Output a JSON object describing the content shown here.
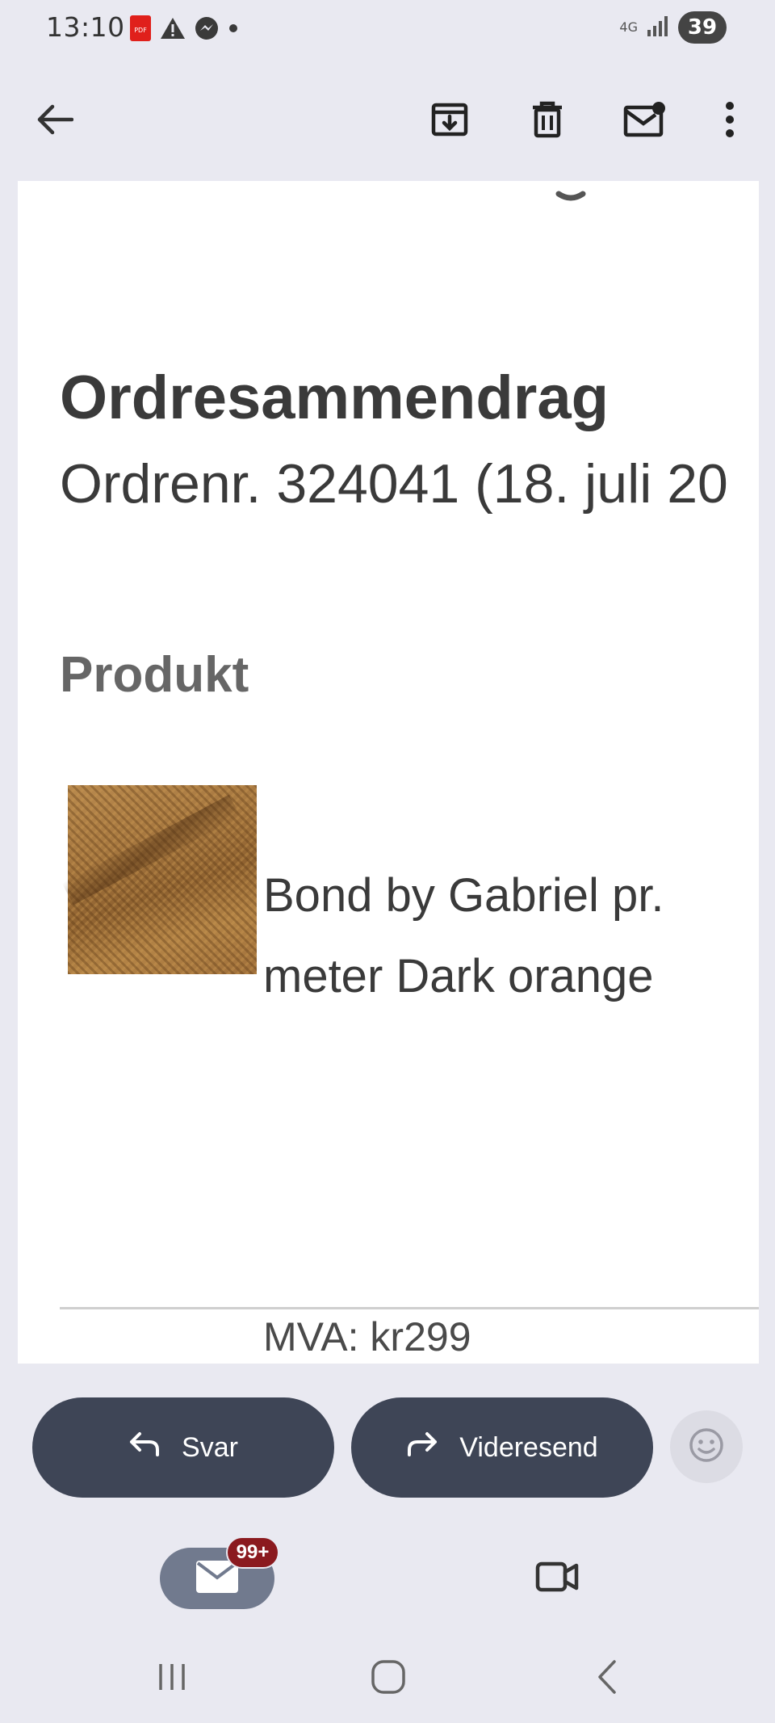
{
  "status_bar": {
    "time": "13:10",
    "network": "4G",
    "battery": "39",
    "icons": [
      "pdf-icon",
      "warning-icon",
      "messenger-icon",
      "dot-icon",
      "signal-icon"
    ]
  },
  "app_bar": {
    "icons": [
      "back-arrow-icon",
      "archive-icon",
      "trash-icon",
      "mark-unread-icon",
      "more-vert-icon"
    ]
  },
  "email": {
    "title": "Ordresammendrag",
    "order_line": "Ordrenr. 324041 (18. juli 20",
    "section_heading": "Produkt",
    "product": {
      "name": "Bond by Gabriel pr. meter Dark orange",
      "vat": "MVA: kr299",
      "image": "fabric-swatch-dark-orange"
    }
  },
  "actions": {
    "reply_label": "Svar",
    "forward_label": "Videresend"
  },
  "bottom_nav": {
    "mail_badge": "99+"
  },
  "colors": {
    "background": "#e9e9f1",
    "pill": "#3e4556",
    "badge": "#8b1a1f",
    "mail_tab": "#717a8e"
  }
}
